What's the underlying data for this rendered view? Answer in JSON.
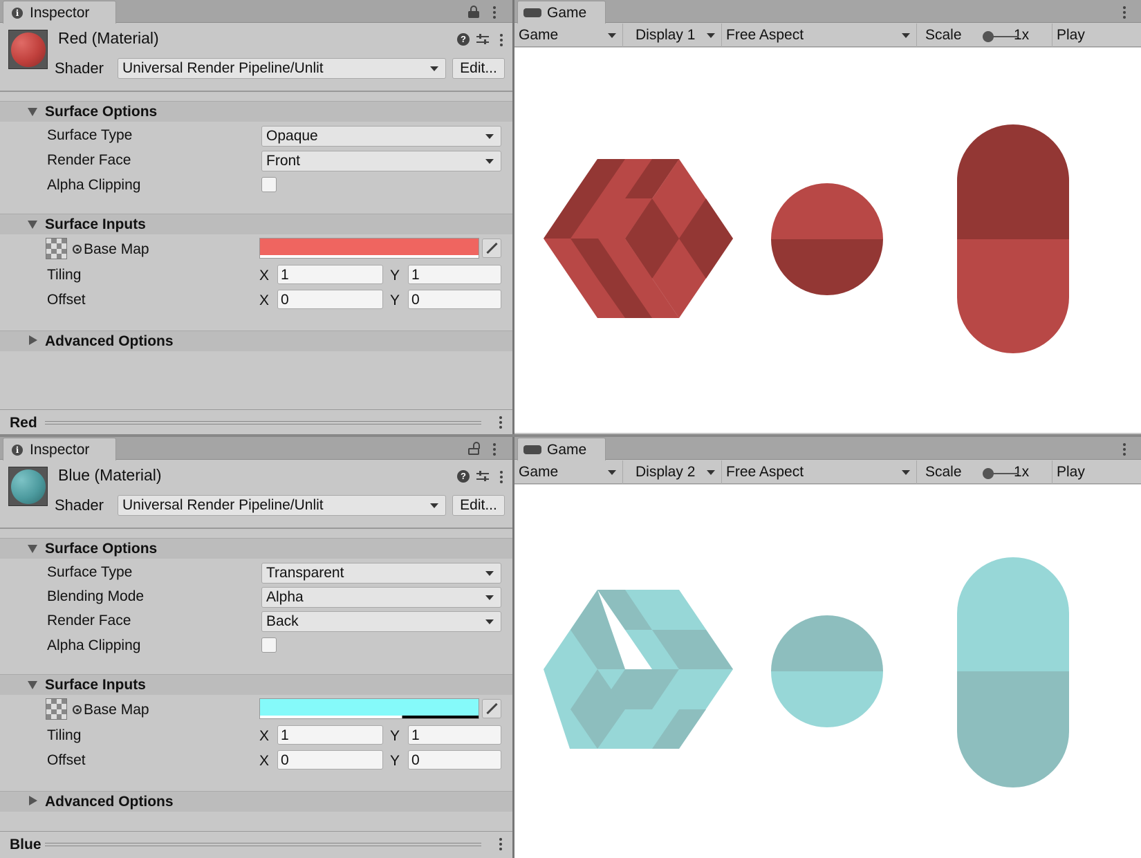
{
  "inspector_top": {
    "tab_label": "Inspector",
    "material_title": "Red (Material)",
    "shader_label": "Shader",
    "shader_value": "Universal Render Pipeline/Unlit",
    "edit_label": "Edit...",
    "surface_options": {
      "title": "Surface Options",
      "surface_type_label": "Surface Type",
      "surface_type_value": "Opaque",
      "render_face_label": "Render Face",
      "render_face_value": "Front",
      "alpha_clipping_label": "Alpha Clipping",
      "alpha_clipping_checked": false
    },
    "surface_inputs": {
      "title": "Surface Inputs",
      "base_map_label": "Base Map",
      "base_map_color": "#ef6560",
      "tiling_label": "Tiling",
      "tiling_x": "1",
      "tiling_y": "1",
      "offset_label": "Offset",
      "offset_x": "0",
      "offset_y": "0",
      "x_label": "X",
      "y_label": "Y"
    },
    "advanced_title": "Advanced Options",
    "footer_label": "Red",
    "preview_color": "#c0403c"
  },
  "inspector_bottom": {
    "tab_label": "Inspector",
    "material_title": "Blue (Material)",
    "shader_label": "Shader",
    "shader_value": "Universal Render Pipeline/Unlit",
    "edit_label": "Edit...",
    "surface_options": {
      "title": "Surface Options",
      "surface_type_label": "Surface Type",
      "surface_type_value": "Transparent",
      "blending_mode_label": "Blending Mode",
      "blending_mode_value": "Alpha",
      "render_face_label": "Render Face",
      "render_face_value": "Back",
      "alpha_clipping_label": "Alpha Clipping",
      "alpha_clipping_checked": false
    },
    "surface_inputs": {
      "title": "Surface Inputs",
      "base_map_label": "Base Map",
      "base_map_color": "#85fafa",
      "base_map_alpha": 0.65,
      "tiling_label": "Tiling",
      "tiling_x": "1",
      "tiling_y": "1",
      "offset_label": "Offset",
      "offset_x": "0",
      "offset_y": "0",
      "x_label": "X",
      "y_label": "Y"
    },
    "advanced_title": "Advanced Options",
    "footer_label": "Blue",
    "preview_color": "#4c9a9e"
  },
  "game_top": {
    "tab_label": "Game",
    "mode": "Game",
    "display": "Display 1",
    "aspect": "Free Aspect",
    "scale_label": "Scale",
    "scale_value": "1x",
    "play_label": "Play Unfocused",
    "colors": {
      "light": "#b84846",
      "dark": "#933734"
    }
  },
  "game_bottom": {
    "tab_label": "Game",
    "mode": "Game",
    "display": "Display 2",
    "aspect": "Free Aspect",
    "scale_label": "Scale",
    "scale_value": "1x",
    "play_label": "Play Unfocused",
    "colors": {
      "light": "#97d7d7",
      "dark": "#8dbebe"
    }
  }
}
